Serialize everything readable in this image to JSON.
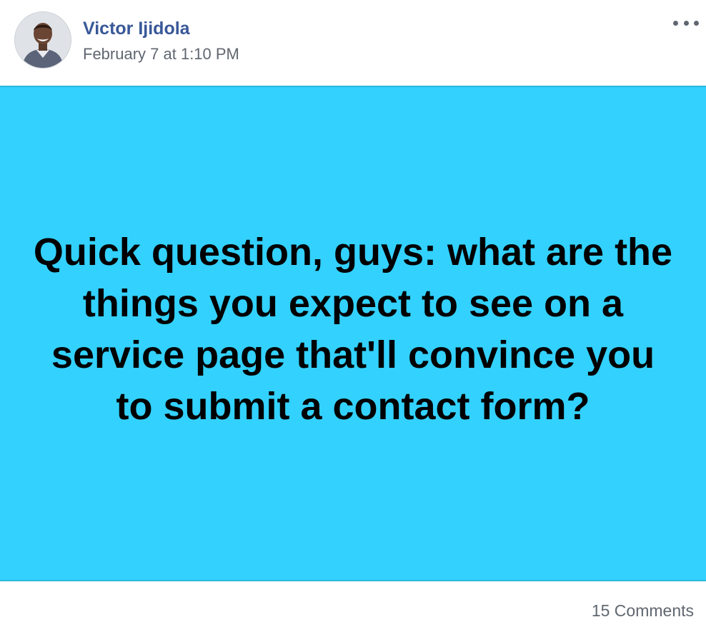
{
  "author": {
    "name": "Victor Ijidola",
    "timestamp": "February 7 at 1:10 PM",
    "avatar_icon": "profile-photo"
  },
  "menu": {
    "icon": "more-options-icon"
  },
  "post": {
    "text": "Quick question, guys: what are the things you expect to see on a service page that'll convince you to submit a contact form?",
    "background_color": "#33d1fd",
    "text_color": "#000000"
  },
  "footer": {
    "comments": "15 Comments"
  },
  "colors": {
    "author_link": "#385898",
    "secondary_text": "#606770"
  }
}
